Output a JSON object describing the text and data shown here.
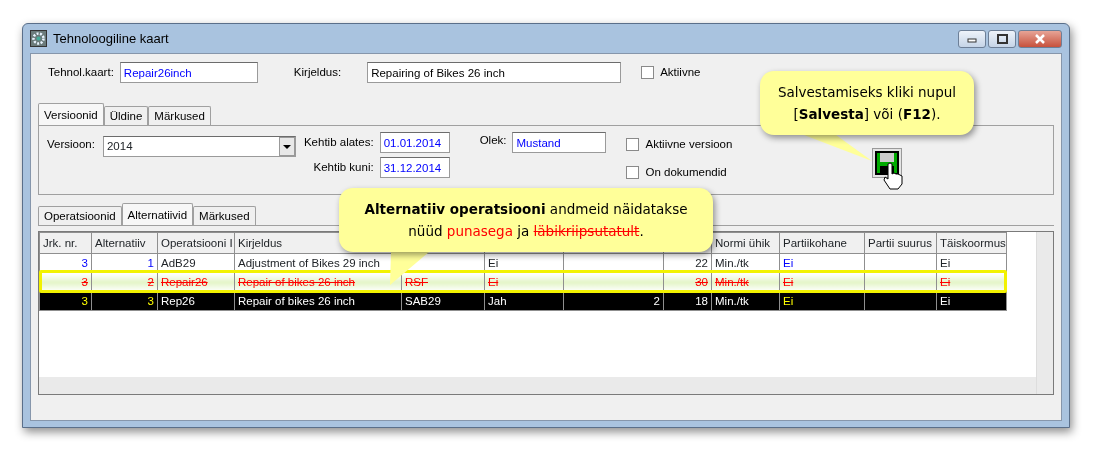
{
  "window": {
    "title": "Tehnoloogiline kaart"
  },
  "header": {
    "card_label": "Tehnol.kaart:",
    "card_value": "Repair26inch",
    "description_label": "Kirjeldus:",
    "description_value": "Repairing of Bikes 26 inch",
    "active": {
      "label": "Aktiivne",
      "checked": false
    }
  },
  "tabs": [
    {
      "label": "Versioonid",
      "selected": true
    },
    {
      "label": "Üldine",
      "selected": false
    },
    {
      "label": "Märkused",
      "selected": false
    }
  ],
  "version": {
    "version_label": "Versioon:",
    "version_value": "2014",
    "valid_from_label": "Kehtib alates:",
    "valid_from": "01.01.2014",
    "valid_to_label": "Kehtib kuni:",
    "valid_to": "31.12.2014",
    "state_label": "Olek:",
    "state_value": "Mustand",
    "checkboxes": [
      {
        "label": "Aktiivne versioon",
        "checked": false
      },
      {
        "label": "On dokumendid",
        "checked": false
      }
    ]
  },
  "inner_tabs": [
    {
      "label": "Operatsioonid",
      "selected": false
    },
    {
      "label": "Alternatiivid",
      "selected": true
    },
    {
      "label": "Märkused",
      "selected": false
    }
  ],
  "table": {
    "columns": [
      "Jrk. nr.",
      "Alternatiiv",
      "Operatsiooni I",
      "Kirjeldus",
      "",
      "",
      "",
      "",
      "Normi ühik",
      "Partiikohane",
      "Partii suurus",
      "Täiskoormus"
    ],
    "rows": [
      {
        "selected": false,
        "struck": false,
        "highlighted": false,
        "cells": [
          "3",
          "1",
          "AdB29",
          "Adjustment of Bikes 29 inch",
          "",
          "Ei",
          "",
          "22",
          "Min./tk",
          "Ei",
          "",
          "Ei"
        ]
      },
      {
        "selected": false,
        "struck": true,
        "highlighted": true,
        "cells": [
          "3",
          "2",
          "Repair26",
          "Repair of bikes 26 inch",
          "RSF",
          "Ei",
          "",
          "30",
          "Min./tk",
          "Ei",
          "",
          "Ei"
        ]
      },
      {
        "selected": true,
        "struck": false,
        "highlighted": false,
        "cells": [
          "3",
          "3",
          "Rep26",
          "Repair of bikes 26 inch",
          "SAB29",
          "Jah",
          "2",
          "18",
          "Min./tk",
          "Ei",
          "",
          "Ei"
        ]
      }
    ]
  },
  "callouts": [
    {
      "kind": "save",
      "lines": [
        [
          {
            "kind": "normal",
            "text": "Salvestamiseks kliki nupul"
          }
        ],
        [
          {
            "kind": "normal",
            "text": "[**Salvesta**] või (**F12**)."
          }
        ]
      ]
    },
    {
      "kind": "alternatives",
      "lines": [
        [
          {
            "kind": "normal",
            "text": "**Alternatiiv operatsiooni** andmeid näidatakse"
          }
        ],
        [
          {
            "kind": "normal",
            "text": "nüüd "
          },
          {
            "kind": "red",
            "text": "punasega"
          },
          {
            "kind": "normal",
            "text": " ja "
          },
          {
            "kind": "red-struck",
            "text": "läbikriipsutatult"
          },
          {
            "kind": "normal",
            "text": "."
          }
        ]
      ]
    }
  ]
}
